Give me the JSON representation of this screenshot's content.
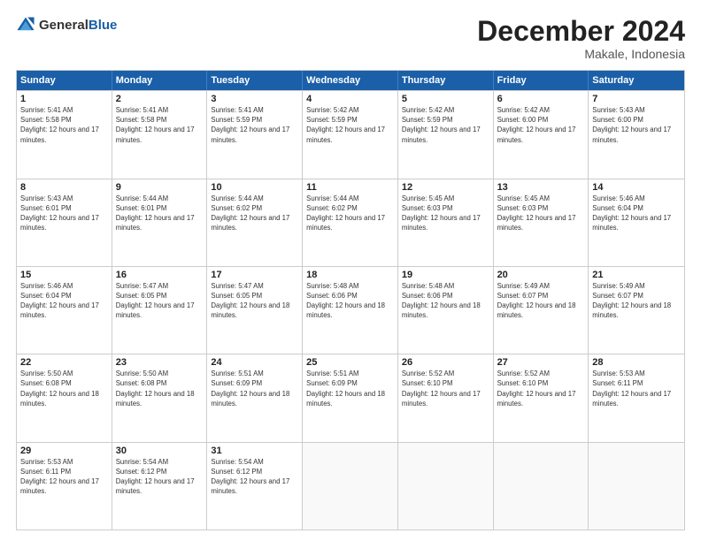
{
  "logo": {
    "general": "General",
    "blue": "Blue"
  },
  "title": {
    "month": "December 2024",
    "location": "Makale, Indonesia"
  },
  "header_days": [
    "Sunday",
    "Monday",
    "Tuesday",
    "Wednesday",
    "Thursday",
    "Friday",
    "Saturday"
  ],
  "weeks": [
    [
      {
        "day": "1",
        "rise": "Sunrise: 5:41 AM",
        "set": "Sunset: 5:58 PM",
        "daylight": "Daylight: 12 hours and 17 minutes."
      },
      {
        "day": "2",
        "rise": "Sunrise: 5:41 AM",
        "set": "Sunset: 5:58 PM",
        "daylight": "Daylight: 12 hours and 17 minutes."
      },
      {
        "day": "3",
        "rise": "Sunrise: 5:41 AM",
        "set": "Sunset: 5:59 PM",
        "daylight": "Daylight: 12 hours and 17 minutes."
      },
      {
        "day": "4",
        "rise": "Sunrise: 5:42 AM",
        "set": "Sunset: 5:59 PM",
        "daylight": "Daylight: 12 hours and 17 minutes."
      },
      {
        "day": "5",
        "rise": "Sunrise: 5:42 AM",
        "set": "Sunset: 5:59 PM",
        "daylight": "Daylight: 12 hours and 17 minutes."
      },
      {
        "day": "6",
        "rise": "Sunrise: 5:42 AM",
        "set": "Sunset: 6:00 PM",
        "daylight": "Daylight: 12 hours and 17 minutes."
      },
      {
        "day": "7",
        "rise": "Sunrise: 5:43 AM",
        "set": "Sunset: 6:00 PM",
        "daylight": "Daylight: 12 hours and 17 minutes."
      }
    ],
    [
      {
        "day": "8",
        "rise": "Sunrise: 5:43 AM",
        "set": "Sunset: 6:01 PM",
        "daylight": "Daylight: 12 hours and 17 minutes."
      },
      {
        "day": "9",
        "rise": "Sunrise: 5:44 AM",
        "set": "Sunset: 6:01 PM",
        "daylight": "Daylight: 12 hours and 17 minutes."
      },
      {
        "day": "10",
        "rise": "Sunrise: 5:44 AM",
        "set": "Sunset: 6:02 PM",
        "daylight": "Daylight: 12 hours and 17 minutes."
      },
      {
        "day": "11",
        "rise": "Sunrise: 5:44 AM",
        "set": "Sunset: 6:02 PM",
        "daylight": "Daylight: 12 hours and 17 minutes."
      },
      {
        "day": "12",
        "rise": "Sunrise: 5:45 AM",
        "set": "Sunset: 6:03 PM",
        "daylight": "Daylight: 12 hours and 17 minutes."
      },
      {
        "day": "13",
        "rise": "Sunrise: 5:45 AM",
        "set": "Sunset: 6:03 PM",
        "daylight": "Daylight: 12 hours and 17 minutes."
      },
      {
        "day": "14",
        "rise": "Sunrise: 5:46 AM",
        "set": "Sunset: 6:04 PM",
        "daylight": "Daylight: 12 hours and 17 minutes."
      }
    ],
    [
      {
        "day": "15",
        "rise": "Sunrise: 5:46 AM",
        "set": "Sunset: 6:04 PM",
        "daylight": "Daylight: 12 hours and 17 minutes."
      },
      {
        "day": "16",
        "rise": "Sunrise: 5:47 AM",
        "set": "Sunset: 6:05 PM",
        "daylight": "Daylight: 12 hours and 17 minutes."
      },
      {
        "day": "17",
        "rise": "Sunrise: 5:47 AM",
        "set": "Sunset: 6:05 PM",
        "daylight": "Daylight: 12 hours and 18 minutes."
      },
      {
        "day": "18",
        "rise": "Sunrise: 5:48 AM",
        "set": "Sunset: 6:06 PM",
        "daylight": "Daylight: 12 hours and 18 minutes."
      },
      {
        "day": "19",
        "rise": "Sunrise: 5:48 AM",
        "set": "Sunset: 6:06 PM",
        "daylight": "Daylight: 12 hours and 18 minutes."
      },
      {
        "day": "20",
        "rise": "Sunrise: 5:49 AM",
        "set": "Sunset: 6:07 PM",
        "daylight": "Daylight: 12 hours and 18 minutes."
      },
      {
        "day": "21",
        "rise": "Sunrise: 5:49 AM",
        "set": "Sunset: 6:07 PM",
        "daylight": "Daylight: 12 hours and 18 minutes."
      }
    ],
    [
      {
        "day": "22",
        "rise": "Sunrise: 5:50 AM",
        "set": "Sunset: 6:08 PM",
        "daylight": "Daylight: 12 hours and 18 minutes."
      },
      {
        "day": "23",
        "rise": "Sunrise: 5:50 AM",
        "set": "Sunset: 6:08 PM",
        "daylight": "Daylight: 12 hours and 18 minutes."
      },
      {
        "day": "24",
        "rise": "Sunrise: 5:51 AM",
        "set": "Sunset: 6:09 PM",
        "daylight": "Daylight: 12 hours and 18 minutes."
      },
      {
        "day": "25",
        "rise": "Sunrise: 5:51 AM",
        "set": "Sunset: 6:09 PM",
        "daylight": "Daylight: 12 hours and 18 minutes."
      },
      {
        "day": "26",
        "rise": "Sunrise: 5:52 AM",
        "set": "Sunset: 6:10 PM",
        "daylight": "Daylight: 12 hours and 17 minutes."
      },
      {
        "day": "27",
        "rise": "Sunrise: 5:52 AM",
        "set": "Sunset: 6:10 PM",
        "daylight": "Daylight: 12 hours and 17 minutes."
      },
      {
        "day": "28",
        "rise": "Sunrise: 5:53 AM",
        "set": "Sunset: 6:11 PM",
        "daylight": "Daylight: 12 hours and 17 minutes."
      }
    ],
    [
      {
        "day": "29",
        "rise": "Sunrise: 5:53 AM",
        "set": "Sunset: 6:11 PM",
        "daylight": "Daylight: 12 hours and 17 minutes."
      },
      {
        "day": "30",
        "rise": "Sunrise: 5:54 AM",
        "set": "Sunset: 6:12 PM",
        "daylight": "Daylight: 12 hours and 17 minutes."
      },
      {
        "day": "31",
        "rise": "Sunrise: 5:54 AM",
        "set": "Sunset: 6:12 PM",
        "daylight": "Daylight: 12 hours and 17 minutes."
      },
      {
        "day": "",
        "rise": "",
        "set": "",
        "daylight": ""
      },
      {
        "day": "",
        "rise": "",
        "set": "",
        "daylight": ""
      },
      {
        "day": "",
        "rise": "",
        "set": "",
        "daylight": ""
      },
      {
        "day": "",
        "rise": "",
        "set": "",
        "daylight": ""
      }
    ]
  ]
}
